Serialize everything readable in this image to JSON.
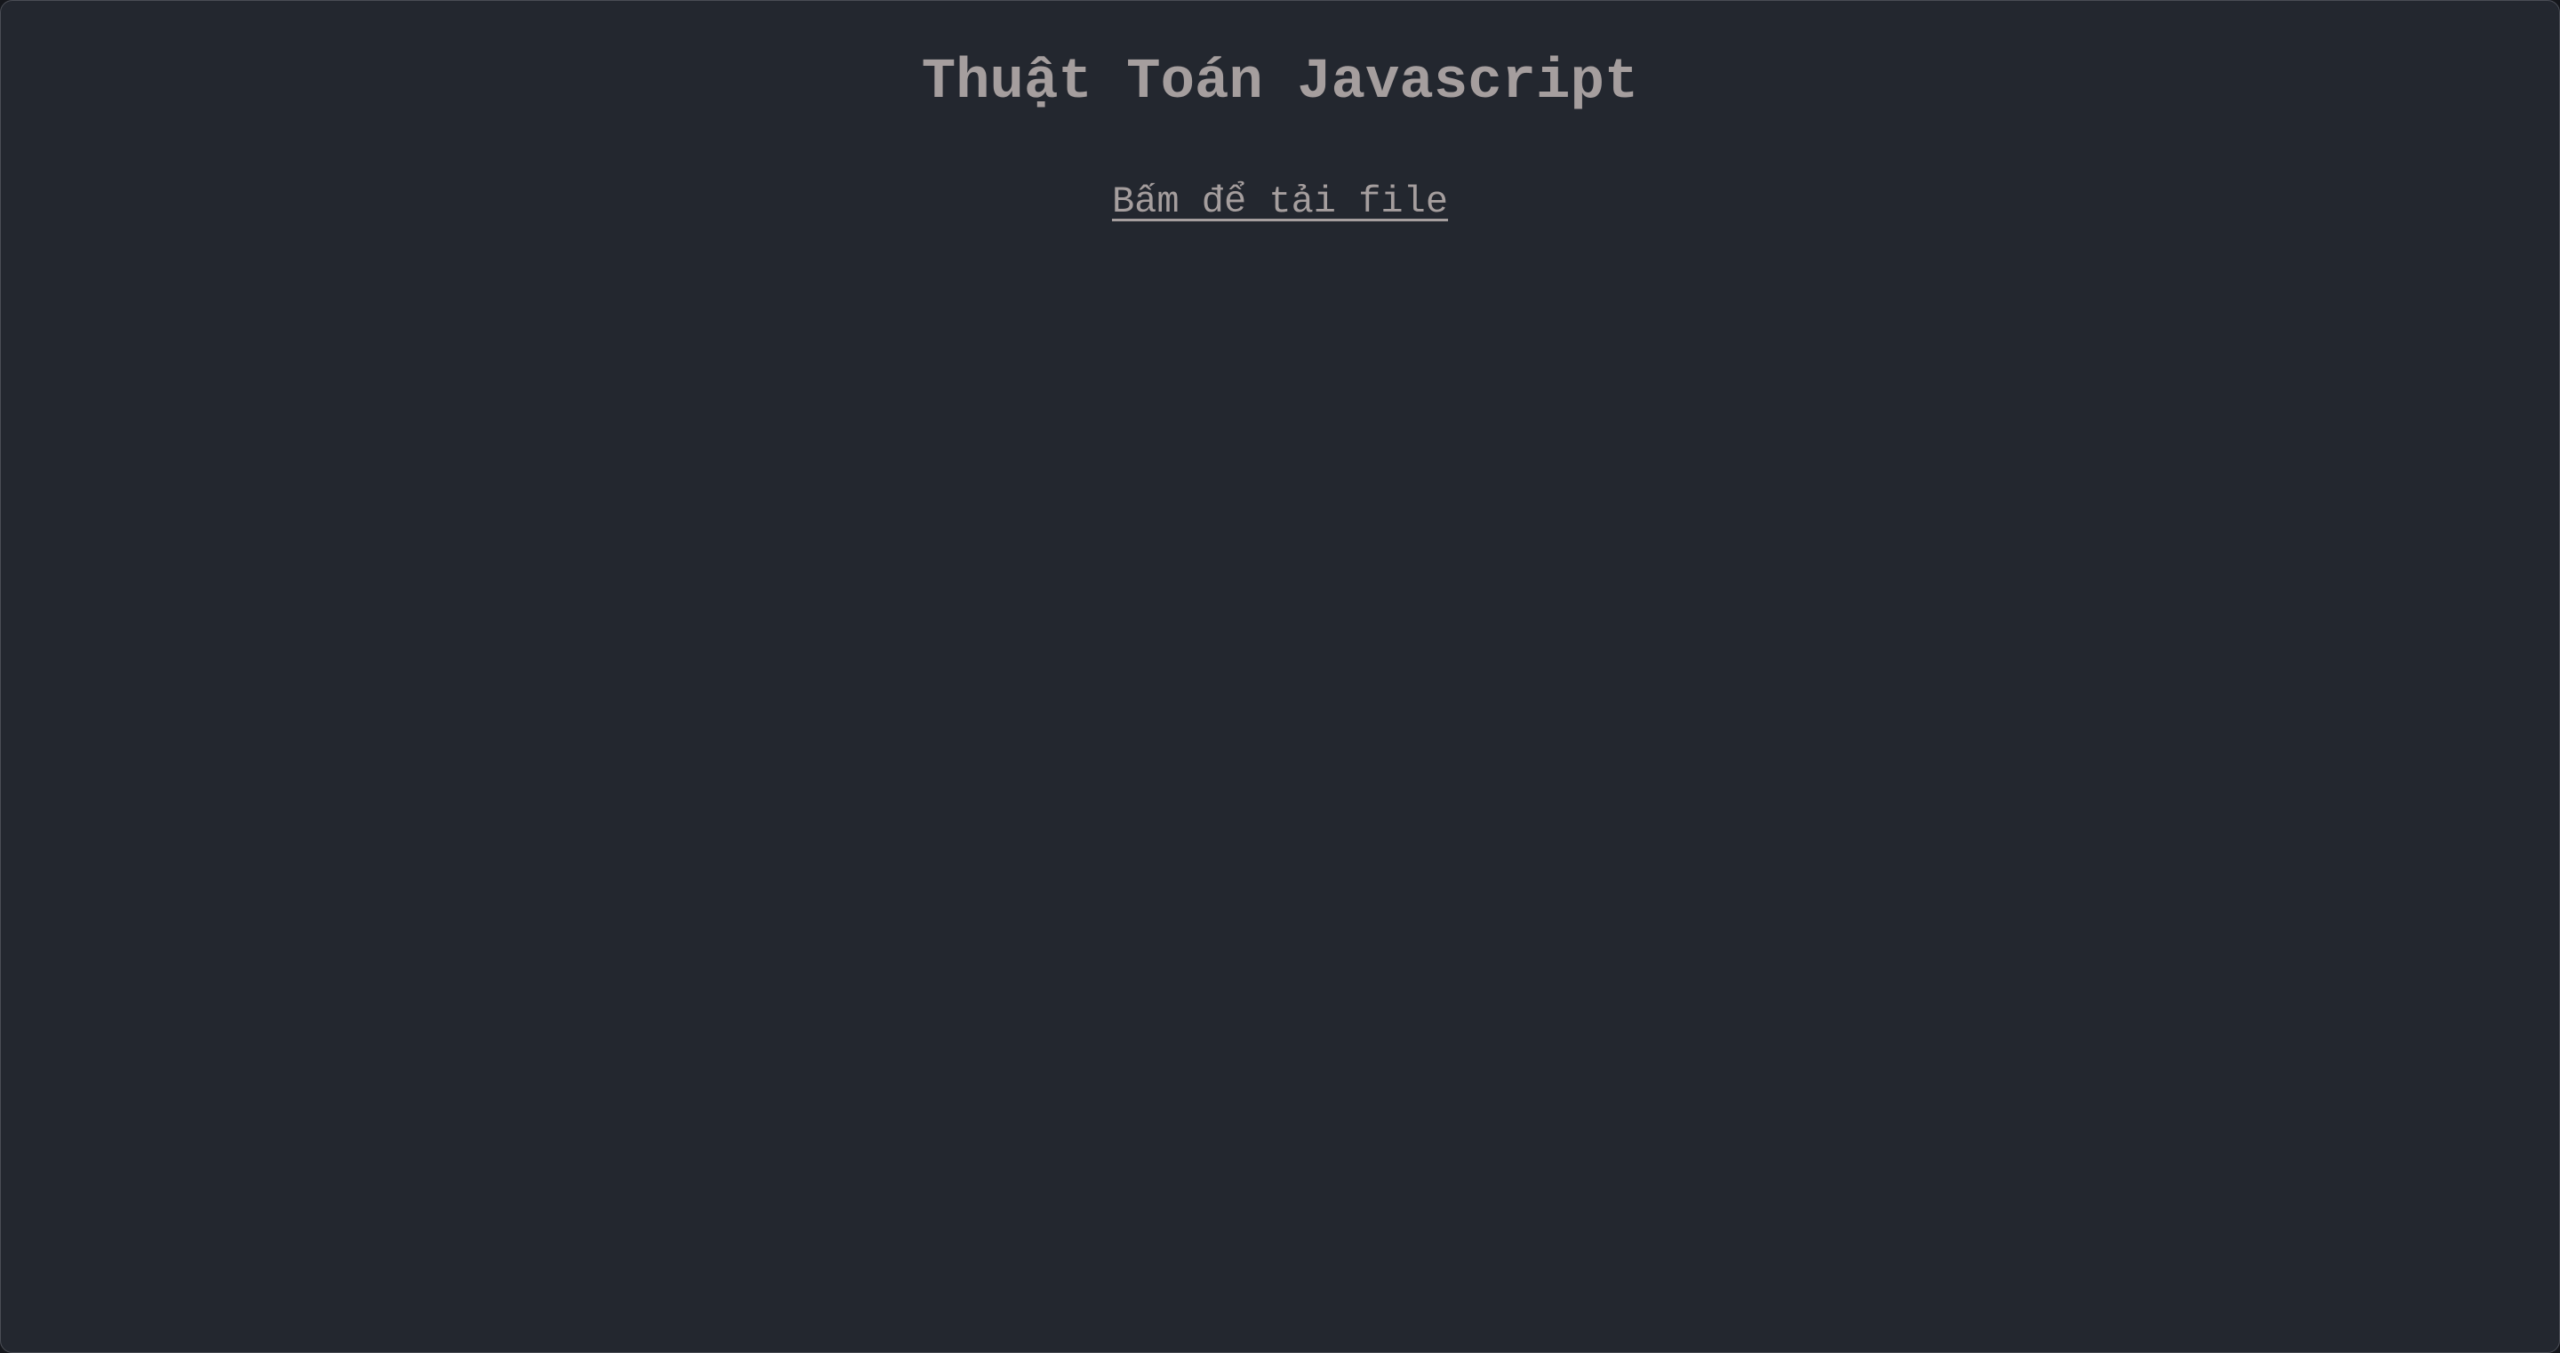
{
  "page": {
    "title": "Thuật Toán Javascript",
    "download_link": "Bấm để tải file"
  },
  "colors": {
    "background": "#23272f",
    "text": "#a59e9e"
  }
}
